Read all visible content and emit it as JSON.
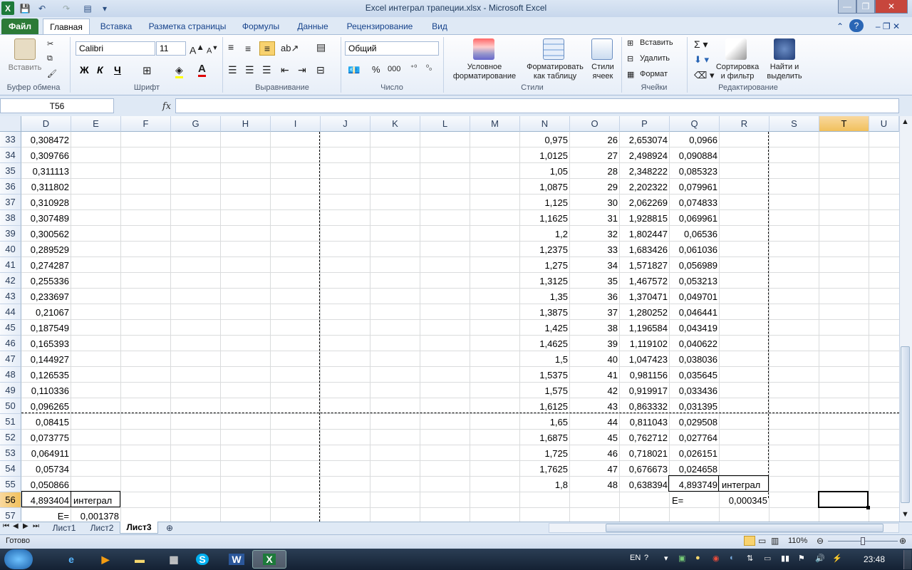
{
  "window": {
    "title": "Excel интеграл трапеции.xlsx  -  Microsoft Excel"
  },
  "tabs": [
    "Файл",
    "Главная",
    "Вставка",
    "Разметка страницы",
    "Формулы",
    "Данные",
    "Рецензирование",
    "Вид"
  ],
  "ribbon": {
    "clipboard": {
      "paste": "Вставить",
      "label": "Буфер обмена"
    },
    "font": {
      "name": "Calibri",
      "size": "11",
      "bold": "Ж",
      "italic": "К",
      "underline": "Ч",
      "label": "Шрифт"
    },
    "alignment": {
      "label": "Выравнивание"
    },
    "number": {
      "format": "Общий",
      "percent": "%",
      "thousands": "000",
      "label": "Число"
    },
    "styles": {
      "conditional": "Условное форматирование",
      "as_table": "Форматировать как таблицу",
      "cell_styles": "Стили ячеек",
      "label": "Стили"
    },
    "cells": {
      "insert": "Вставить",
      "delete": "Удалить",
      "format": "Формат",
      "label": "Ячейки"
    },
    "editing": {
      "sort": "Сортировка и фильтр",
      "find": "Найти и выделить",
      "label": "Редактирование"
    }
  },
  "formula_bar": {
    "name_box": "T56",
    "fx": "fx",
    "content": ""
  },
  "columns": [
    "D",
    "E",
    "F",
    "G",
    "H",
    "I",
    "J",
    "K",
    "L",
    "M",
    "N",
    "O",
    "P",
    "Q",
    "R",
    "S",
    "T",
    "U"
  ],
  "selected_column": "T",
  "selected_row": "56",
  "rows": [
    {
      "n": "33",
      "D": "0,308472",
      "N": "0,975",
      "O": "26",
      "P": "2,653074",
      "Q": "0,0966"
    },
    {
      "n": "34",
      "D": "0,309766",
      "N": "1,0125",
      "O": "27",
      "P": "2,498924",
      "Q": "0,090884"
    },
    {
      "n": "35",
      "D": "0,311113",
      "N": "1,05",
      "O": "28",
      "P": "2,348222",
      "Q": "0,085323"
    },
    {
      "n": "36",
      "D": "0,311802",
      "N": "1,0875",
      "O": "29",
      "P": "2,202322",
      "Q": "0,079961"
    },
    {
      "n": "37",
      "D": "0,310928",
      "N": "1,125",
      "O": "30",
      "P": "2,062269",
      "Q": "0,074833"
    },
    {
      "n": "38",
      "D": "0,307489",
      "N": "1,1625",
      "O": "31",
      "P": "1,928815",
      "Q": "0,069961"
    },
    {
      "n": "39",
      "D": "0,300562",
      "N": "1,2",
      "O": "32",
      "P": "1,802447",
      "Q": "0,06536"
    },
    {
      "n": "40",
      "D": "0,289529",
      "N": "1,2375",
      "O": "33",
      "P": "1,683426",
      "Q": "0,061036"
    },
    {
      "n": "41",
      "D": "0,274287",
      "N": "1,275",
      "O": "34",
      "P": "1,571827",
      "Q": "0,056989"
    },
    {
      "n": "42",
      "D": "0,255336",
      "N": "1,3125",
      "O": "35",
      "P": "1,467572",
      "Q": "0,053213"
    },
    {
      "n": "43",
      "D": "0,233697",
      "N": "1,35",
      "O": "36",
      "P": "1,370471",
      "Q": "0,049701"
    },
    {
      "n": "44",
      "D": "0,21067",
      "N": "1,3875",
      "O": "37",
      "P": "1,280252",
      "Q": "0,046441"
    },
    {
      "n": "45",
      "D": "0,187549",
      "N": "1,425",
      "O": "38",
      "P": "1,196584",
      "Q": "0,043419"
    },
    {
      "n": "46",
      "D": "0,165393",
      "N": "1,4625",
      "O": "39",
      "P": "1,119102",
      "Q": "0,040622"
    },
    {
      "n": "47",
      "D": "0,144927",
      "N": "1,5",
      "O": "40",
      "P": "1,047423",
      "Q": "0,038036"
    },
    {
      "n": "48",
      "D": "0,126535",
      "N": "1,5375",
      "O": "41",
      "P": "0,981156",
      "Q": "0,035645"
    },
    {
      "n": "49",
      "D": "0,110336",
      "N": "1,575",
      "O": "42",
      "P": "0,919917",
      "Q": "0,033436"
    },
    {
      "n": "50",
      "D": "0,096265",
      "N": "1,6125",
      "O": "43",
      "P": "0,863332",
      "Q": "0,031395"
    },
    {
      "n": "51",
      "D": "0,08415",
      "N": "1,65",
      "O": "44",
      "P": "0,811043",
      "Q": "0,029508"
    },
    {
      "n": "52",
      "D": "0,073775",
      "N": "1,6875",
      "O": "45",
      "P": "0,762712",
      "Q": "0,027764"
    },
    {
      "n": "53",
      "D": "0,064911",
      "N": "1,725",
      "O": "46",
      "P": "0,718021",
      "Q": "0,026151"
    },
    {
      "n": "54",
      "D": "0,05734",
      "N": "1,7625",
      "O": "47",
      "P": "0,676673",
      "Q": "0,024658"
    },
    {
      "n": "55",
      "D": "0,050866",
      "N": "1,8",
      "O": "48",
      "P": "0,638394",
      "Q": "4,893749",
      "R": "интеграл"
    },
    {
      "n": "56",
      "D": "4,893404",
      "E": "интеграл",
      "Q": "E=",
      "R": "0,000345"
    },
    {
      "n": "57",
      "D": "E=",
      "E": "0,001378"
    }
  ],
  "sheets": [
    "Лист1",
    "Лист2",
    "Лист3"
  ],
  "active_sheet": "Лист3",
  "status": {
    "ready": "Готово",
    "zoom": "110%"
  },
  "taskbar": {
    "lang": "EN",
    "time": "23:48"
  }
}
